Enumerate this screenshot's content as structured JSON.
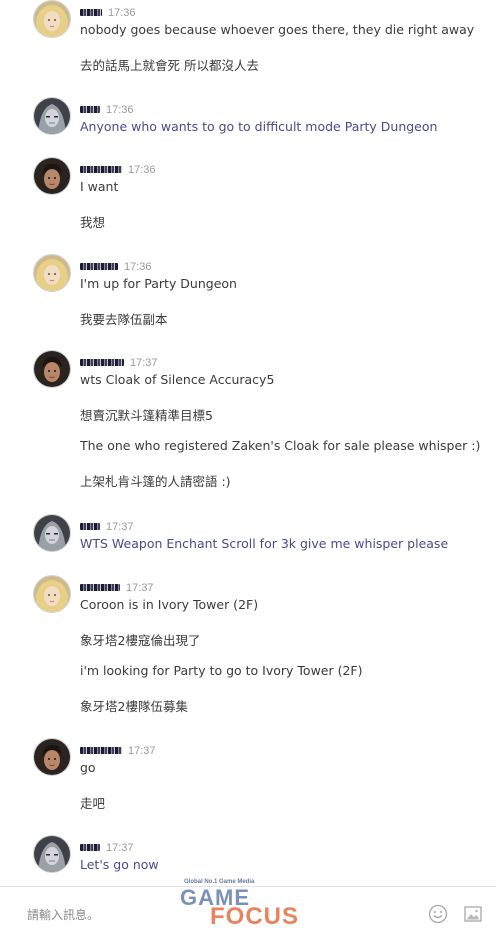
{
  "messages": [
    {
      "time": "17:36",
      "avatar": "blonde-elf-avatar",
      "lines": [
        {
          "text": "nobody goes because whoever goes there, they die right away",
          "link": false
        },
        {
          "text": "去的話馬上就會死 所以都沒人去",
          "link": false
        }
      ]
    },
    {
      "time": "17:36",
      "avatar": "dark-elf-avatar",
      "lines": [
        {
          "text": "Anyone who wants to go to difficult mode Party Dungeon",
          "link": true
        }
      ]
    },
    {
      "time": "17:36",
      "avatar": "dark-haired-male-avatar",
      "lines": [
        {
          "text": "I want",
          "link": false
        },
        {
          "text": "我想",
          "link": false
        }
      ]
    },
    {
      "time": "17:36",
      "avatar": "blonde-elf-avatar",
      "lines": [
        {
          "text": "I'm up for Party Dungeon",
          "link": false
        },
        {
          "text": "我要去隊伍副本",
          "link": false
        }
      ]
    },
    {
      "time": "17:37",
      "avatar": "dark-haired-male-avatar",
      "lines": [
        {
          "text": "wts Cloak of Silence Accuracy5",
          "link": false
        },
        {
          "text": "想賣沉默斗篷精準目標5",
          "link": false
        },
        {
          "text": "The one who registered Zaken's Cloak for sale please whisper :)",
          "link": false
        },
        {
          "text": "上架札肯斗篷的人請密語 :)",
          "link": false
        }
      ]
    },
    {
      "time": "17:37",
      "avatar": "dark-elf-avatar",
      "lines": [
        {
          "text": "WTS Weapon Enchant Scroll for 3k give me whisper please",
          "link": true
        }
      ]
    },
    {
      "time": "17:37",
      "avatar": "blonde-elf-avatar",
      "lines": [
        {
          "text": "Coroon is in Ivory Tower (2F)",
          "link": false
        },
        {
          "text": "象牙塔2樓寇倫出現了",
          "link": false
        },
        {
          "text": "i'm looking for Party to go to Ivory Tower (2F)",
          "link": false
        },
        {
          "text": "象牙塔2樓隊伍募集",
          "link": false
        }
      ]
    },
    {
      "time": "17:37",
      "avatar": "dark-haired-male-avatar",
      "lines": [
        {
          "text": "go",
          "link": false
        },
        {
          "text": "走吧",
          "link": false
        }
      ]
    },
    {
      "time": "17:37",
      "avatar": "dark-elf-avatar",
      "lines": [
        {
          "text": "Let's go now",
          "link": true
        }
      ]
    }
  ],
  "input": {
    "placeholder": "請輸入訊息。",
    "emoji_icon": "smiley-icon",
    "image_icon": "image-icon"
  },
  "watermark": {
    "tagline": "Global No.1 Game Media",
    "word1": "GAME",
    "word2": "FOCUS"
  },
  "colors": {
    "text": "#3a3a3a",
    "link_text": "#4a4a8c",
    "time": "#9a9a9a",
    "watermark_blue": "#6e86b0",
    "watermark_orange": "#e6764e"
  }
}
